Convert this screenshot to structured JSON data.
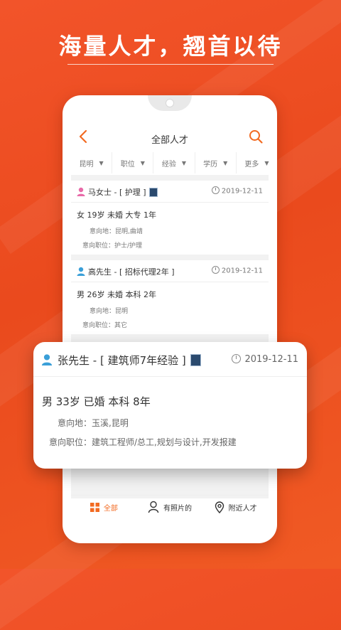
{
  "banner": {
    "headline": "海量人才，翘首以待"
  },
  "header": {
    "title": "全部人才",
    "back_icon": "chevron-left-icon",
    "search_icon": "search-icon",
    "accent": "#f26a21"
  },
  "filters": [
    {
      "label": "昆明"
    },
    {
      "label": "职位"
    },
    {
      "label": "经验"
    },
    {
      "label": "学历"
    },
    {
      "label": "更多"
    }
  ],
  "candidates": [
    {
      "name": "马女士 - [ 护理 ]",
      "date": "2019-12-11",
      "summary": "女 19岁 未婚 大专 1年",
      "location_label": "意向地：",
      "location_value": "昆明,曲靖",
      "position_label": "意向职位：",
      "position_value": "护士/护理"
    },
    {
      "name": "高先生 - [ 招标代理2年 ]",
      "date": "2019-12-11",
      "summary": "男 26岁 未婚 本科 2年",
      "location_label": "意向地：",
      "location_value": "昆明",
      "position_label": "意向职位：",
      "position_value": "其它"
    }
  ],
  "featured": {
    "name": "张先生 - [ 建筑师7年经验 ]",
    "date": "2019-12-11",
    "summary": "男 33岁 已婚 本科 8年",
    "location_label": "意向地：",
    "location_value": "玉溪,昆明",
    "position_label": "意向职位：",
    "position_value": "建筑工程师/总工,规划与设计,开发报建"
  },
  "nav": [
    {
      "label": "全部",
      "icon": "grid-icon"
    },
    {
      "label": "有照片的",
      "icon": "person-icon"
    },
    {
      "label": "附近人才",
      "icon": "location-pin-icon"
    }
  ]
}
